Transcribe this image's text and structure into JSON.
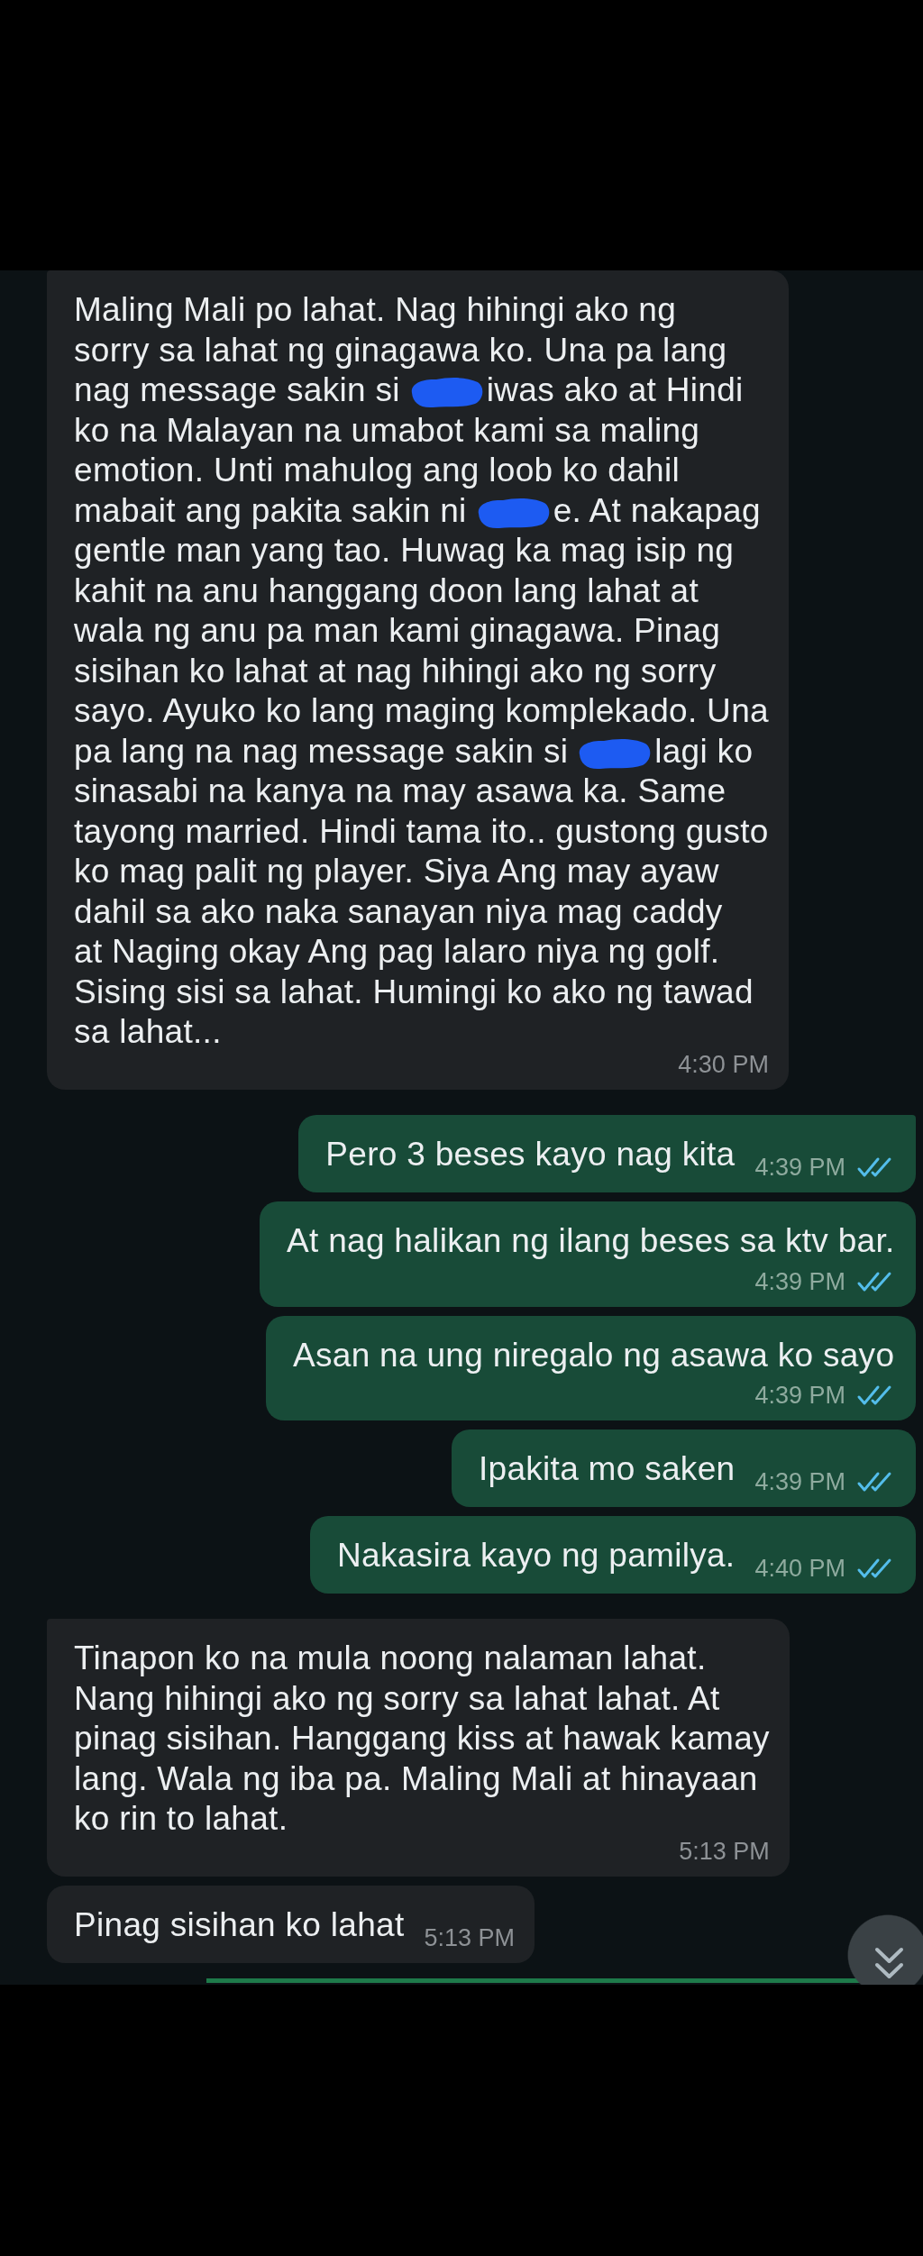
{
  "chat": {
    "messages": [
      {
        "kind": "incoming",
        "tail": true,
        "parts": [
          {
            "kind": "text",
            "text": "Maling Mali po lahat. Nag hihingi ako ng\nsorry sa lahat ng ginagawa ko. Una pa lang\nnag message sakin si"
          },
          {
            "kind": "redaction"
          },
          {
            "kind": "text",
            "text": "iwas ako at Hindi\nko na Malayan na umabot kami sa maling\nemotion. Unti mahulog ang loob ko dahil\nmabait ang pakita sakin ni"
          },
          {
            "kind": "redaction"
          },
          {
            "kind": "text",
            "text": "e. At nakapag\ngentle man yang tao. Huwag ka mag isip ng\nkahit na anu hanggang doon lang lahat at\nwala ng anu pa man kami ginagawa. Pinag\nsisihan ko lahat at nag hihingi ako ng sorry\nsayo. Ayuko ko lang maging komplekado. Una\npa lang na nag message sakin si"
          },
          {
            "kind": "redaction"
          },
          {
            "kind": "text",
            "text": "lagi ko\nsinasabi na kanya na may asawa ka. Same\ntayong married. Hindi tama ito.. gustong gusto\nko mag palit ng player. Siya Ang may ayaw\ndahil sa ako naka sanayan niya mag caddy\nat Naging okay Ang pag lalaro niya ng golf.\nSising sisi sa lahat. Humingi ko ako ng tawad\nsa lahat..."
          }
        ],
        "time": "4:30 PM"
      },
      {
        "kind": "outgoing",
        "tail": true,
        "text": "Pero 3 beses kayo nag kita",
        "time": "4:39 PM",
        "read": true
      },
      {
        "kind": "outgoing",
        "tail": false,
        "text": "At nag halikan ng ilang beses sa ktv bar.",
        "time": "4:39 PM",
        "read": true
      },
      {
        "kind": "outgoing",
        "tail": false,
        "text": "Asan na ung niregalo ng asawa ko sayo",
        "time": "4:39 PM",
        "read": true
      },
      {
        "kind": "outgoing",
        "tail": false,
        "text": "Ipakita mo saken",
        "time": "4:39 PM",
        "read": true
      },
      {
        "kind": "outgoing",
        "tail": false,
        "text": "Nakasira kayo ng pamilya.",
        "time": "4:40 PM",
        "read": true
      },
      {
        "kind": "incoming",
        "tail": true,
        "text": "Tinapon ko na mula noong nalaman lahat.\nNang hihingi ako ng sorry sa lahat lahat. At\npinag sisihan. Hanggang kiss at hawak kamay\nlang. Wala ng iba pa. Maling Mali at hinayaan\nko rin to lahat.",
        "time": "5:13 PM"
      },
      {
        "kind": "incoming",
        "tail": false,
        "text": "Pinag sisihan ko lahat",
        "time": "5:13 PM"
      }
    ]
  }
}
